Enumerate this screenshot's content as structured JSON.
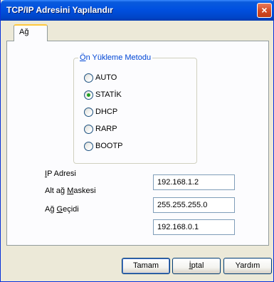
{
  "window": {
    "title": "TCP/IP Adresini Yapılandır",
    "close_glyph": "×"
  },
  "tabs": [
    {
      "label": "Ağ",
      "selected": true
    }
  ],
  "method_group": {
    "legend_underlined": "Ö",
    "legend_rest": "n Yükleme Metodu",
    "options": [
      {
        "label": "AUTO",
        "checked": false
      },
      {
        "label": "STATİK",
        "checked": true
      },
      {
        "label": "DHCP",
        "checked": false
      },
      {
        "label": "RARP",
        "checked": false
      },
      {
        "label": "BOOTP",
        "checked": false
      }
    ]
  },
  "fields": {
    "ip": {
      "label_underlined": "I",
      "label_rest": "P Adresi",
      "value": "192.168.1.2"
    },
    "mask": {
      "label_pre": "Alt ağ ",
      "label_underlined": "M",
      "label_rest": "askesi",
      "value": "255.255.255.0"
    },
    "gateway": {
      "label_pre": "Ağ ",
      "label_underlined": "G",
      "label_rest": "eçidi",
      "value": "192.168.0.1"
    }
  },
  "buttons": {
    "ok": "Tamam",
    "cancel_underlined": "İ",
    "cancel_rest": "ptal",
    "help": "Yardım"
  }
}
